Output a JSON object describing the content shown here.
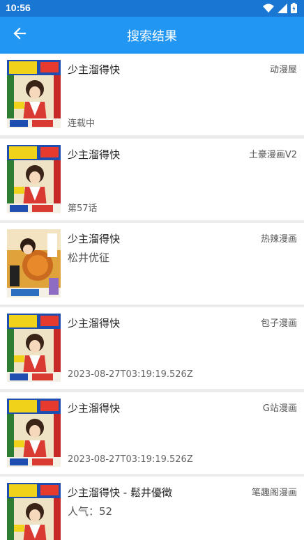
{
  "status_bar": {
    "time": "10:56",
    "icons": [
      "wifi-icon",
      "signal-icon",
      "battery-icon"
    ]
  },
  "app_bar": {
    "title": "搜索结果",
    "back_icon": "arrow-left-icon"
  },
  "results": [
    {
      "title": "少主溜得快",
      "source": "动漫屋",
      "subtitle": "",
      "info": "连载中",
      "cover": "cover-jump"
    },
    {
      "title": "少主溜得快",
      "source": "土豪漫画V2",
      "subtitle": "",
      "info": "第57话",
      "cover": "cover-jump"
    },
    {
      "title": "少主溜得快",
      "source": "热辣漫画",
      "subtitle": "松井优征",
      "info": "",
      "cover": "cover-volume"
    },
    {
      "title": "少主溜得快",
      "source": "包子漫画",
      "subtitle": "",
      "info": "2023-08-27T03:19:19.526Z",
      "cover": "cover-jump"
    },
    {
      "title": "少主溜得快",
      "source": "G站漫画",
      "subtitle": "",
      "info": "2023-08-27T03:19:19.526Z",
      "cover": "cover-jump"
    },
    {
      "title": "少主溜得快 - 鬆井優徵",
      "source": "笔趣阁漫画",
      "subtitle": "人气：52",
      "info": "",
      "cover": "cover-jump"
    }
  ],
  "colors": {
    "status_bar": "#1976d2",
    "app_bar": "#2196f3",
    "background": "#ececec",
    "card": "#ffffff"
  }
}
